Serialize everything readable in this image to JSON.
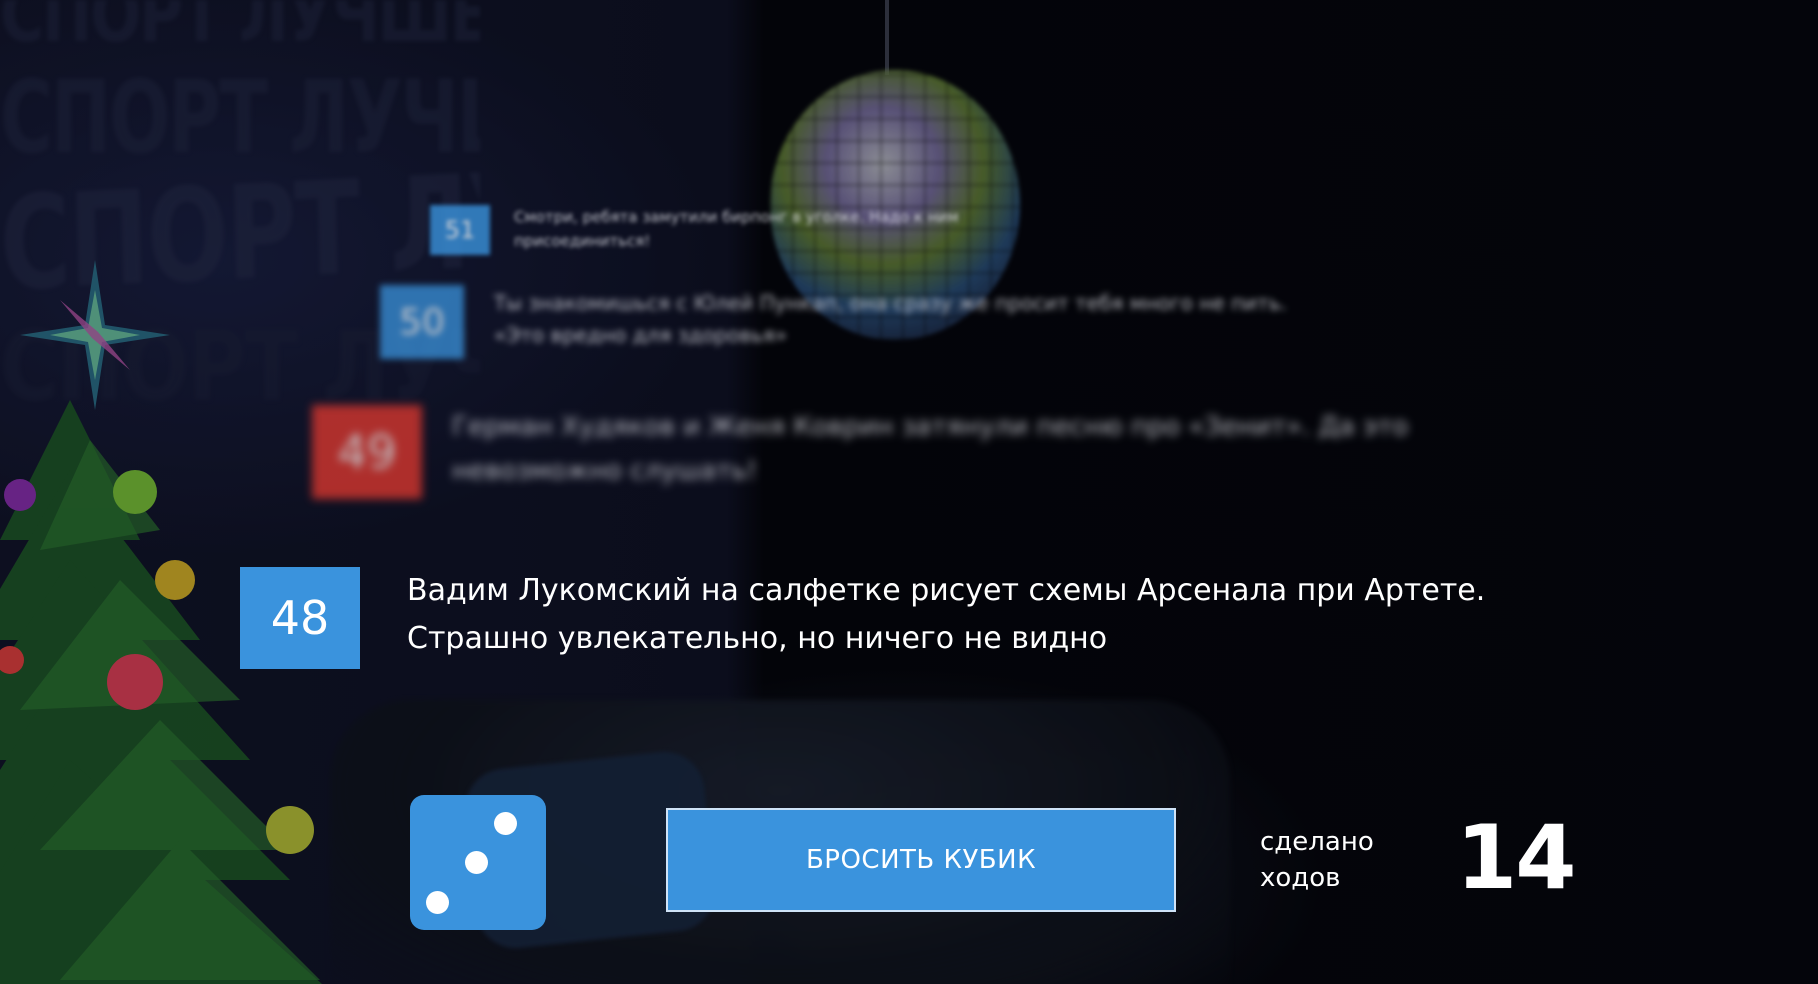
{
  "colors": {
    "accent": "#3a93dd",
    "alert": "#e4392f",
    "text": "#ffffff"
  },
  "background": {
    "wall_text": "СПОРТ ЛУЧШЕ"
  },
  "events": [
    {
      "number": "51",
      "text": "Смотри, ребята замутили бирпонг в уголке. Надо к ним присоединиться!",
      "color": "#3a93dd"
    },
    {
      "number": "50",
      "text": "Ты знакомишься с Юлей Пункап, она сразу же просит тебя много не пить. «Это вредно для здоровья»",
      "color": "#3a93dd"
    },
    {
      "number": "49",
      "text": "Герман Худяков и Женя Коврин затянули песню про «Зенит». Да это невозможно слушать!",
      "color": "#e4392f"
    },
    {
      "number": "48",
      "text": "Вадим Лукомский на салфетке рисует схемы Арсенала при Артете. Страшно увлекательно, но ничего не видно",
      "color": "#3a93dd"
    }
  ],
  "dice": {
    "value": 3,
    "icon": "dice-three-icon"
  },
  "controls": {
    "roll_label": "БРОСИТЬ КУБИК",
    "moves_label": "сделано ходов",
    "moves_count": "14"
  }
}
